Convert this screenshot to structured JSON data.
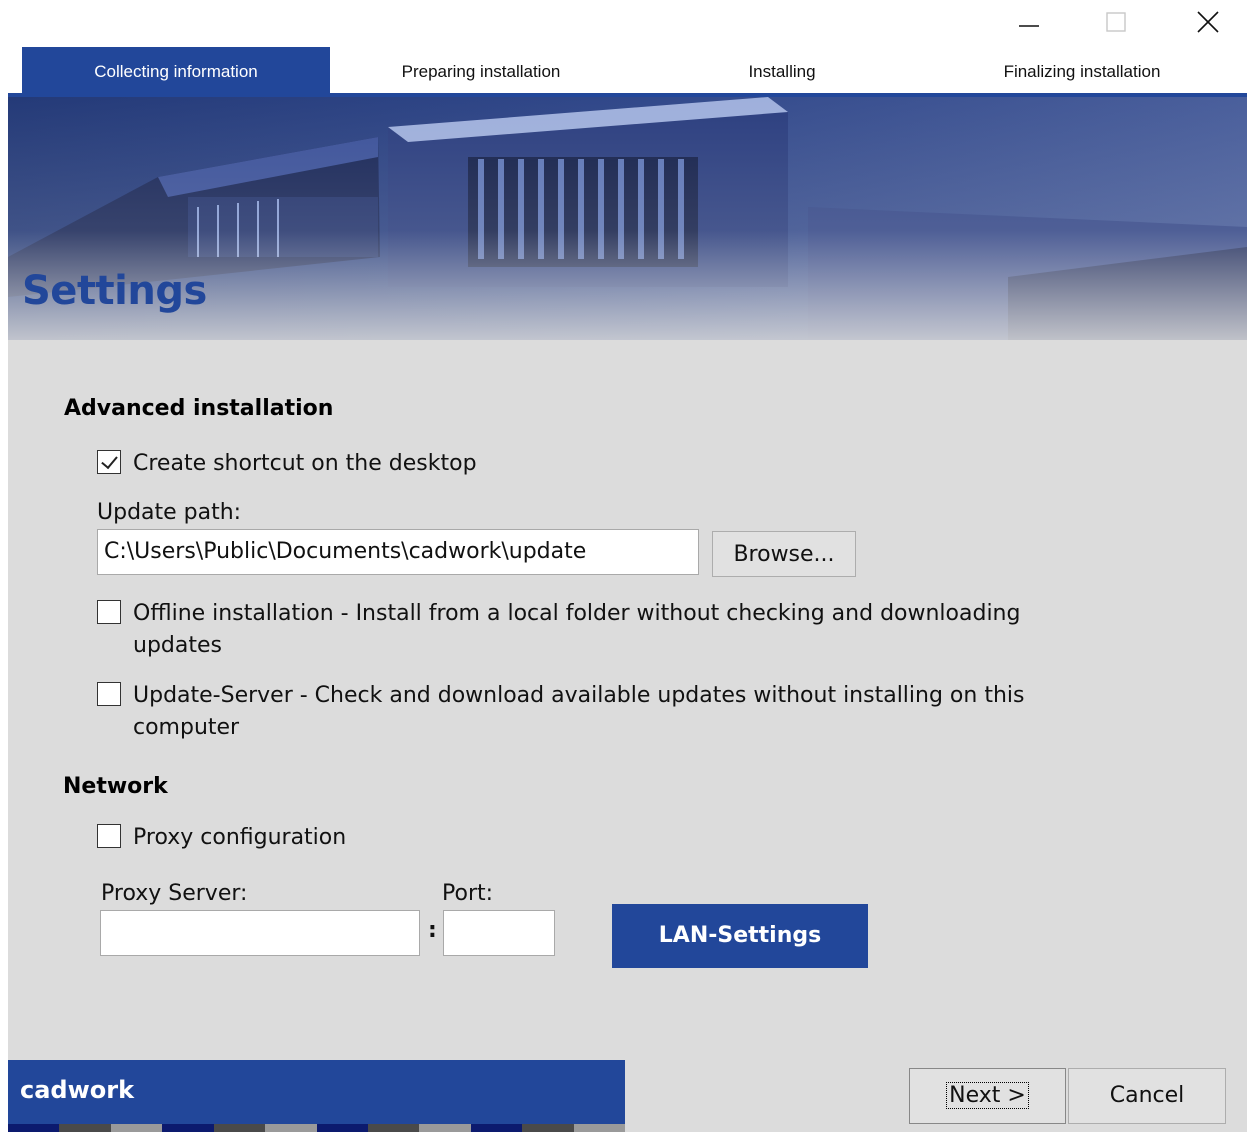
{
  "window": {
    "controls": {
      "minimize": "minimize-icon",
      "maximize": "maximize-icon",
      "close": "close-icon"
    }
  },
  "steps": [
    {
      "label": "Collecting information",
      "active": true
    },
    {
      "label": "Preparing installation",
      "active": false
    },
    {
      "label": "Installing",
      "active": false
    },
    {
      "label": "Finalizing installation",
      "active": false
    }
  ],
  "page": {
    "title": "Settings"
  },
  "advanced": {
    "heading": "Advanced installation",
    "create_shortcut": {
      "label": "Create shortcut on the desktop",
      "checked": true
    },
    "update_path": {
      "label": "Update path:",
      "value": "C:\\Users\\Public\\Documents\\cadwork\\update",
      "browse_label": "Browse..."
    },
    "offline": {
      "label_line1": "Offline installation - Install from a local folder without checking and downloading",
      "label_line2": "updates",
      "checked": false
    },
    "update_server": {
      "label_line1": "Update-Server - Check and download available updates without installing on this",
      "label_line2": "computer",
      "checked": false
    }
  },
  "network": {
    "heading": "Network",
    "proxy_config": {
      "label": "Proxy configuration",
      "checked": false
    },
    "proxy_server": {
      "label": "Proxy Server:",
      "value": ""
    },
    "separator": ":",
    "port": {
      "label": "Port:",
      "value": ""
    },
    "lan_settings_label": "LAN-Settings"
  },
  "footer": {
    "brand": "cadwork",
    "next_label": "Next >",
    "cancel_label": "Cancel"
  },
  "colors": {
    "accent": "#22479a",
    "content_bg": "#dcdcdc"
  }
}
